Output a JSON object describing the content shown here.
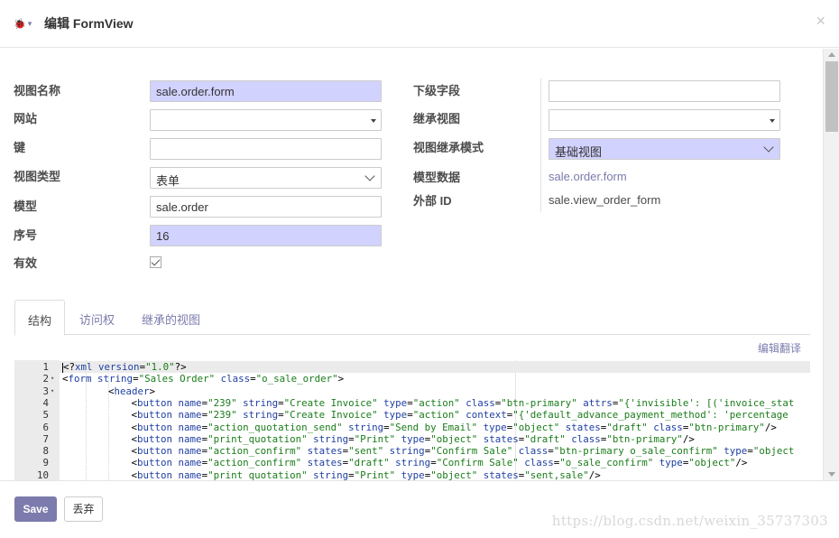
{
  "header": {
    "title": "编辑 FormView",
    "bug_icon": "bug-icon",
    "close_label": "×"
  },
  "form": {
    "left": [
      {
        "label": "视图名称",
        "value": "sale.order.form",
        "kind": "required-text"
      },
      {
        "label": "网站",
        "value": "",
        "kind": "select"
      },
      {
        "label": "键",
        "value": "",
        "kind": "text"
      },
      {
        "label": "视图类型",
        "value": "表单",
        "kind": "dropdown"
      },
      {
        "label": "模型",
        "value": "sale.order",
        "kind": "text"
      },
      {
        "label": "序号",
        "value": "16",
        "kind": "required-text"
      },
      {
        "label": "有效",
        "value": "checked",
        "kind": "checkbox"
      }
    ],
    "right": [
      {
        "label": "下级字段",
        "value": "",
        "kind": "text"
      },
      {
        "label": "继承视图",
        "value": "",
        "kind": "select"
      },
      {
        "label": "视图继承模式",
        "value": "基础视图",
        "kind": "required-dropdown"
      },
      {
        "label": "模型数据",
        "value": "sale.order.form",
        "kind": "link"
      },
      {
        "label": "外部 ID",
        "value": "sale.view_order_form",
        "kind": "readonly"
      }
    ]
  },
  "tabs": [
    {
      "label": "结构",
      "active": true
    },
    {
      "label": "访问权",
      "active": false
    },
    {
      "label": "继承的视图",
      "active": false
    }
  ],
  "edit_translate": "编辑翻译",
  "editor": {
    "lines": [
      {
        "n": "1",
        "fold": "",
        "indent": 0,
        "code": "<?xml version=\"1.0\"?>"
      },
      {
        "n": "2",
        "fold": "▾",
        "indent": 0,
        "code": "<form string=\"Sales Order\" class=\"o_sale_order\">"
      },
      {
        "n": "3",
        "fold": "▾",
        "indent": 1,
        "code": "<header>"
      },
      {
        "n": "4",
        "fold": "",
        "indent": 2,
        "code": "<button name=\"239\" string=\"Create Invoice\" type=\"action\" class=\"btn-primary\" attrs=\"{'invisible': [('invoice_stat"
      },
      {
        "n": "5",
        "fold": "",
        "indent": 2,
        "code": "<button name=\"239\" string=\"Create Invoice\" type=\"action\" context=\"{'default_advance_payment_method': 'percentage"
      },
      {
        "n": "6",
        "fold": "",
        "indent": 2,
        "code": "<button name=\"action_quotation_send\" string=\"Send by Email\" type=\"object\" states=\"draft\" class=\"btn-primary\"/>"
      },
      {
        "n": "7",
        "fold": "",
        "indent": 2,
        "code": "<button name=\"print_quotation\" string=\"Print\" type=\"object\" states=\"draft\" class=\"btn-primary\"/>"
      },
      {
        "n": "8",
        "fold": "",
        "indent": 2,
        "code": "<button name=\"action_confirm\" states=\"sent\" string=\"Confirm Sale\" class=\"btn-primary o_sale_confirm\" type=\"object"
      },
      {
        "n": "9",
        "fold": "",
        "indent": 2,
        "code": "<button name=\"action_confirm\" states=\"draft\" string=\"Confirm Sale\" class=\"o_sale_confirm\" type=\"object\"/>"
      },
      {
        "n": "10",
        "fold": "",
        "indent": 2,
        "code": "<button name=\"print_quotation\" string=\"Print\" type=\"object\" states=\"sent,sale\"/>"
      }
    ]
  },
  "footer": {
    "save_label": "Save",
    "discard_label": "丢弃",
    "watermark": "https://blog.csdn.net/weixin_35737303"
  },
  "colors": {
    "brand": "#7c7bad",
    "required_bg": "#d2d2ff"
  }
}
